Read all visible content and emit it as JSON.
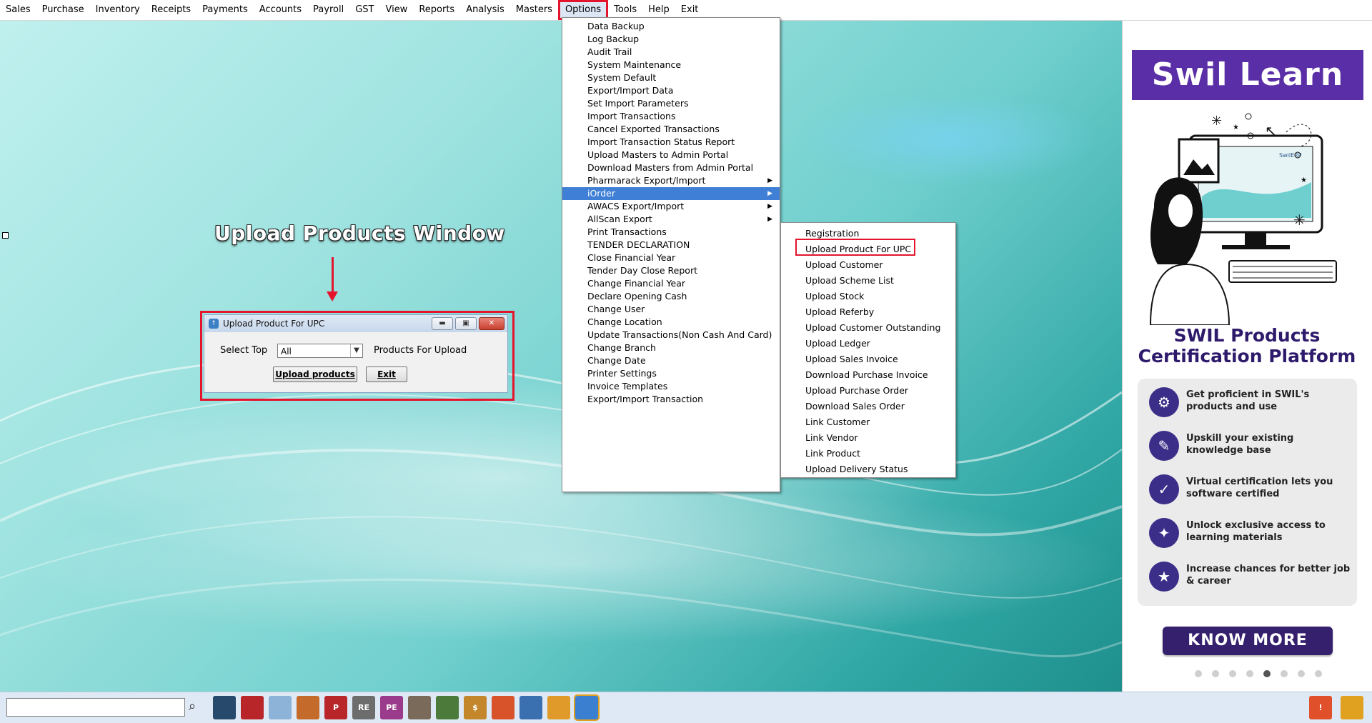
{
  "menubar": {
    "items": [
      "Sales",
      "Purchase",
      "Inventory",
      "Receipts",
      "Payments",
      "Accounts",
      "Payroll",
      "GST",
      "View",
      "Reports",
      "Analysis",
      "Masters",
      "Options",
      "Tools",
      "Help",
      "Exit"
    ],
    "active": "Options"
  },
  "annotation": {
    "title": "Upload Products Window"
  },
  "upload_window": {
    "title": "Upload Product For UPC",
    "select_label": "Select Top",
    "select_value": "All",
    "products_label": "Products For Upload",
    "upload_button": "Upload products",
    "exit_button": "Exit"
  },
  "options_menu": {
    "items": [
      {
        "label": "Data Backup"
      },
      {
        "label": "Log Backup"
      },
      {
        "label": "Audit Trail"
      },
      {
        "label": "System Maintenance"
      },
      {
        "label": "System Default"
      },
      {
        "label": "Export/Import Data"
      },
      {
        "label": "Set Import Parameters"
      },
      {
        "label": "Import Transactions"
      },
      {
        "label": "Cancel Exported Transactions"
      },
      {
        "label": "Import Transaction Status Report"
      },
      {
        "label": "Upload Masters to Admin Portal"
      },
      {
        "label": "Download Masters from Admin Portal"
      },
      {
        "label": "Pharmarack Export/Import",
        "submenu": true
      },
      {
        "label": "iOrder",
        "submenu": true,
        "highlighted": true
      },
      {
        "label": "AWACS Export/Import",
        "submenu": true
      },
      {
        "label": "AllScan Export",
        "submenu": true
      },
      {
        "label": "Print Transactions"
      },
      {
        "label": "TENDER DECLARATION"
      },
      {
        "label": "Close Financial Year"
      },
      {
        "label": "Tender Day Close Report"
      },
      {
        "label": "Change Financial Year"
      },
      {
        "label": "Declare Opening Cash"
      },
      {
        "label": "Change User"
      },
      {
        "label": "Change Location"
      },
      {
        "label": "Update Transactions(Non Cash And Card)"
      },
      {
        "label": "Change Branch"
      },
      {
        "label": "Change Date"
      },
      {
        "label": "Printer Settings"
      },
      {
        "label": "Invoice Templates"
      },
      {
        "label": "Export/Import Transaction"
      }
    ]
  },
  "iorder_menu": {
    "items": [
      "Registration",
      "Upload Product For UPC",
      "Upload Customer",
      "Upload Scheme List",
      "Upload Stock",
      "Upload Referby",
      "Upload Customer Outstanding",
      "Upload Ledger",
      "Upload Sales Invoice",
      "Download Purchase Invoice",
      "Upload Purchase Order",
      "Download Sales Order",
      "Link Customer",
      "Link Vendor",
      "Link Product",
      "Upload Delivery Status"
    ],
    "boxed": "Upload Product For UPC"
  },
  "ad": {
    "header": "Swil Learn",
    "subtitle_line1": "SWIL Products",
    "subtitle_line2": "Certification Platform",
    "monitor_brand": "SwilERP",
    "features": [
      {
        "icon": "growth-icon",
        "glyph": "⚙",
        "text": "Get proficient in SWIL's products and use"
      },
      {
        "icon": "book-icon",
        "glyph": "✎",
        "text": "Upskill your existing knowledge base"
      },
      {
        "icon": "certificate-icon",
        "glyph": "✓",
        "text": "Virtual certification lets you software certified"
      },
      {
        "icon": "unlock-icon",
        "glyph": "✦",
        "text": "Unlock exclusive access to learning materials"
      },
      {
        "icon": "career-icon",
        "glyph": "★",
        "text": "Increase chances for better job & career"
      }
    ],
    "button": "KNOW MORE",
    "dots_total": 8,
    "dots_active": 5
  },
  "taskbar": {
    "search_value": "",
    "icons": [
      {
        "name": "ledger-icon",
        "glyph": "",
        "color": "#27496b"
      },
      {
        "name": "report-book-icon",
        "glyph": "",
        "color": "#b8262a"
      },
      {
        "name": "upload-person-icon",
        "glyph": "",
        "color": "#8db3d9"
      },
      {
        "name": "product-icon",
        "glyph": "",
        "color": "#c46a2a"
      },
      {
        "name": "pdf-icon",
        "glyph": "P",
        "color": "#b8262a"
      },
      {
        "name": "receipt-icon",
        "glyph": "RE",
        "color": "#6d6d6d"
      },
      {
        "name": "purchase-entry-icon",
        "glyph": "PE",
        "color": "#9b3b8c"
      },
      {
        "name": "person-box-icon",
        "glyph": "",
        "color": "#7a6a5a"
      },
      {
        "name": "inventory-icon",
        "glyph": "",
        "color": "#4b7a3a"
      },
      {
        "name": "money-bag-icon",
        "glyph": "$",
        "color": "#c4862a"
      },
      {
        "name": "shapes-icon",
        "glyph": "",
        "color": "#d9532a"
      },
      {
        "name": "printer-icon",
        "glyph": "",
        "color": "#3a6fb0"
      },
      {
        "name": "boxes-icon",
        "glyph": "",
        "color": "#e09a2a"
      },
      {
        "name": "documents-icon",
        "glyph": "",
        "color": "#3a7fd0"
      }
    ],
    "right_icons": [
      {
        "name": "announcement-icon",
        "glyph": "!",
        "color": "#e0502a"
      },
      {
        "name": "notification-bell-icon",
        "glyph": "",
        "color": "#e0a020"
      }
    ]
  }
}
